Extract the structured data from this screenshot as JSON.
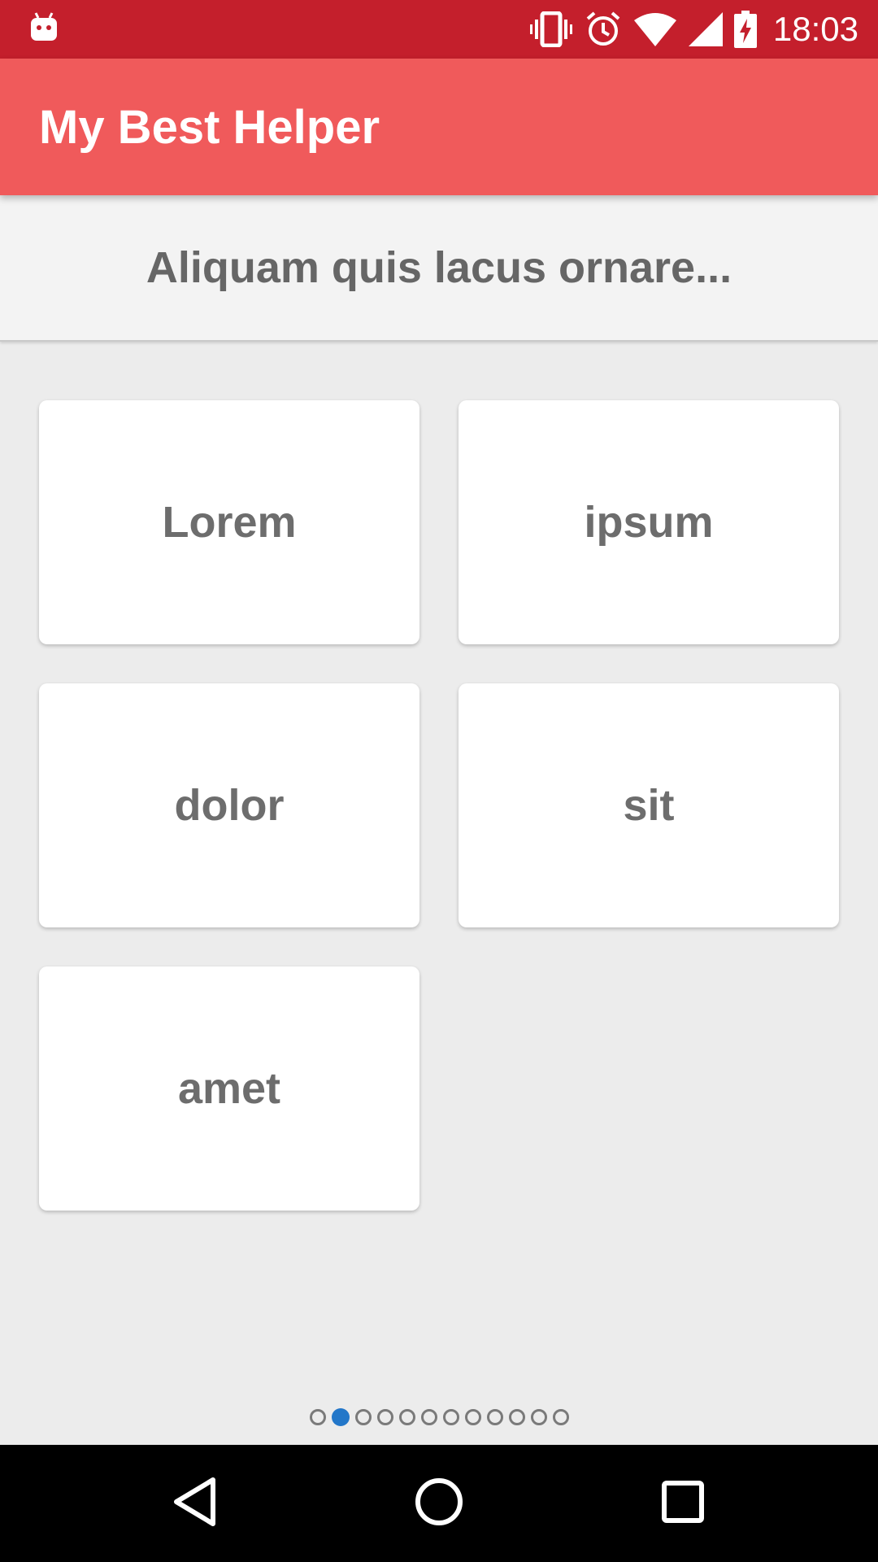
{
  "status_bar": {
    "time": "18:03",
    "icons": [
      "android-icon",
      "vibrate-icon",
      "alarm-icon",
      "wifi-icon",
      "signal-icon",
      "battery-charging-icon"
    ]
  },
  "app_bar": {
    "title": "My Best Helper"
  },
  "banner": {
    "text": "Aliquam quis lacus ornare..."
  },
  "cards": [
    {
      "label": "Lorem"
    },
    {
      "label": "ipsum"
    },
    {
      "label": "dolor"
    },
    {
      "label": "sit"
    },
    {
      "label": "amet"
    }
  ],
  "pager": {
    "total_pages": 12,
    "current_page": 2
  },
  "nav_bar": {
    "buttons": [
      "back-icon",
      "home-icon",
      "recents-icon"
    ]
  },
  "colors": {
    "status_bar": "#c41f2c",
    "app_bar": "#f05a5b",
    "active_dot": "#2377c9"
  }
}
